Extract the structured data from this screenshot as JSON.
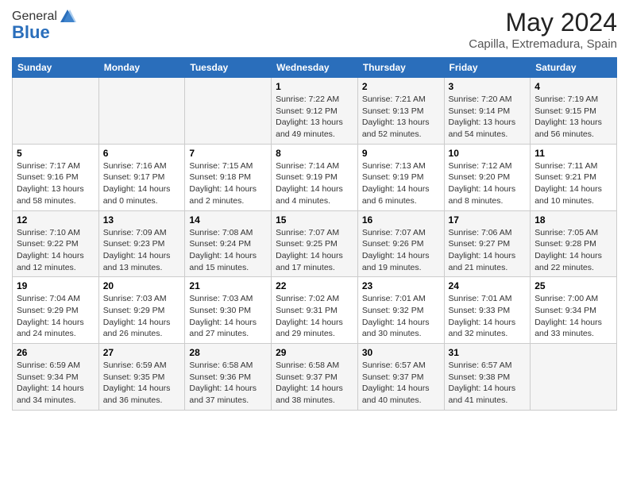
{
  "header": {
    "logo_general": "General",
    "logo_blue": "Blue",
    "month": "May 2024",
    "location": "Capilla, Extremadura, Spain"
  },
  "days_of_week": [
    "Sunday",
    "Monday",
    "Tuesday",
    "Wednesday",
    "Thursday",
    "Friday",
    "Saturday"
  ],
  "weeks": [
    [
      {
        "day": "",
        "info": ""
      },
      {
        "day": "",
        "info": ""
      },
      {
        "day": "",
        "info": ""
      },
      {
        "day": "1",
        "info": "Sunrise: 7:22 AM\nSunset: 9:12 PM\nDaylight: 13 hours\nand 49 minutes."
      },
      {
        "day": "2",
        "info": "Sunrise: 7:21 AM\nSunset: 9:13 PM\nDaylight: 13 hours\nand 52 minutes."
      },
      {
        "day": "3",
        "info": "Sunrise: 7:20 AM\nSunset: 9:14 PM\nDaylight: 13 hours\nand 54 minutes."
      },
      {
        "day": "4",
        "info": "Sunrise: 7:19 AM\nSunset: 9:15 PM\nDaylight: 13 hours\nand 56 minutes."
      }
    ],
    [
      {
        "day": "5",
        "info": "Sunrise: 7:17 AM\nSunset: 9:16 PM\nDaylight: 13 hours\nand 58 minutes."
      },
      {
        "day": "6",
        "info": "Sunrise: 7:16 AM\nSunset: 9:17 PM\nDaylight: 14 hours\nand 0 minutes."
      },
      {
        "day": "7",
        "info": "Sunrise: 7:15 AM\nSunset: 9:18 PM\nDaylight: 14 hours\nand 2 minutes."
      },
      {
        "day": "8",
        "info": "Sunrise: 7:14 AM\nSunset: 9:19 PM\nDaylight: 14 hours\nand 4 minutes."
      },
      {
        "day": "9",
        "info": "Sunrise: 7:13 AM\nSunset: 9:19 PM\nDaylight: 14 hours\nand 6 minutes."
      },
      {
        "day": "10",
        "info": "Sunrise: 7:12 AM\nSunset: 9:20 PM\nDaylight: 14 hours\nand 8 minutes."
      },
      {
        "day": "11",
        "info": "Sunrise: 7:11 AM\nSunset: 9:21 PM\nDaylight: 14 hours\nand 10 minutes."
      }
    ],
    [
      {
        "day": "12",
        "info": "Sunrise: 7:10 AM\nSunset: 9:22 PM\nDaylight: 14 hours\nand 12 minutes."
      },
      {
        "day": "13",
        "info": "Sunrise: 7:09 AM\nSunset: 9:23 PM\nDaylight: 14 hours\nand 13 minutes."
      },
      {
        "day": "14",
        "info": "Sunrise: 7:08 AM\nSunset: 9:24 PM\nDaylight: 14 hours\nand 15 minutes."
      },
      {
        "day": "15",
        "info": "Sunrise: 7:07 AM\nSunset: 9:25 PM\nDaylight: 14 hours\nand 17 minutes."
      },
      {
        "day": "16",
        "info": "Sunrise: 7:07 AM\nSunset: 9:26 PM\nDaylight: 14 hours\nand 19 minutes."
      },
      {
        "day": "17",
        "info": "Sunrise: 7:06 AM\nSunset: 9:27 PM\nDaylight: 14 hours\nand 21 minutes."
      },
      {
        "day": "18",
        "info": "Sunrise: 7:05 AM\nSunset: 9:28 PM\nDaylight: 14 hours\nand 22 minutes."
      }
    ],
    [
      {
        "day": "19",
        "info": "Sunrise: 7:04 AM\nSunset: 9:29 PM\nDaylight: 14 hours\nand 24 minutes."
      },
      {
        "day": "20",
        "info": "Sunrise: 7:03 AM\nSunset: 9:29 PM\nDaylight: 14 hours\nand 26 minutes."
      },
      {
        "day": "21",
        "info": "Sunrise: 7:03 AM\nSunset: 9:30 PM\nDaylight: 14 hours\nand 27 minutes."
      },
      {
        "day": "22",
        "info": "Sunrise: 7:02 AM\nSunset: 9:31 PM\nDaylight: 14 hours\nand 29 minutes."
      },
      {
        "day": "23",
        "info": "Sunrise: 7:01 AM\nSunset: 9:32 PM\nDaylight: 14 hours\nand 30 minutes."
      },
      {
        "day": "24",
        "info": "Sunrise: 7:01 AM\nSunset: 9:33 PM\nDaylight: 14 hours\nand 32 minutes."
      },
      {
        "day": "25",
        "info": "Sunrise: 7:00 AM\nSunset: 9:34 PM\nDaylight: 14 hours\nand 33 minutes."
      }
    ],
    [
      {
        "day": "26",
        "info": "Sunrise: 6:59 AM\nSunset: 9:34 PM\nDaylight: 14 hours\nand 34 minutes."
      },
      {
        "day": "27",
        "info": "Sunrise: 6:59 AM\nSunset: 9:35 PM\nDaylight: 14 hours\nand 36 minutes."
      },
      {
        "day": "28",
        "info": "Sunrise: 6:58 AM\nSunset: 9:36 PM\nDaylight: 14 hours\nand 37 minutes."
      },
      {
        "day": "29",
        "info": "Sunrise: 6:58 AM\nSunset: 9:37 PM\nDaylight: 14 hours\nand 38 minutes."
      },
      {
        "day": "30",
        "info": "Sunrise: 6:57 AM\nSunset: 9:37 PM\nDaylight: 14 hours\nand 40 minutes."
      },
      {
        "day": "31",
        "info": "Sunrise: 6:57 AM\nSunset: 9:38 PM\nDaylight: 14 hours\nand 41 minutes."
      },
      {
        "day": "",
        "info": ""
      }
    ]
  ]
}
